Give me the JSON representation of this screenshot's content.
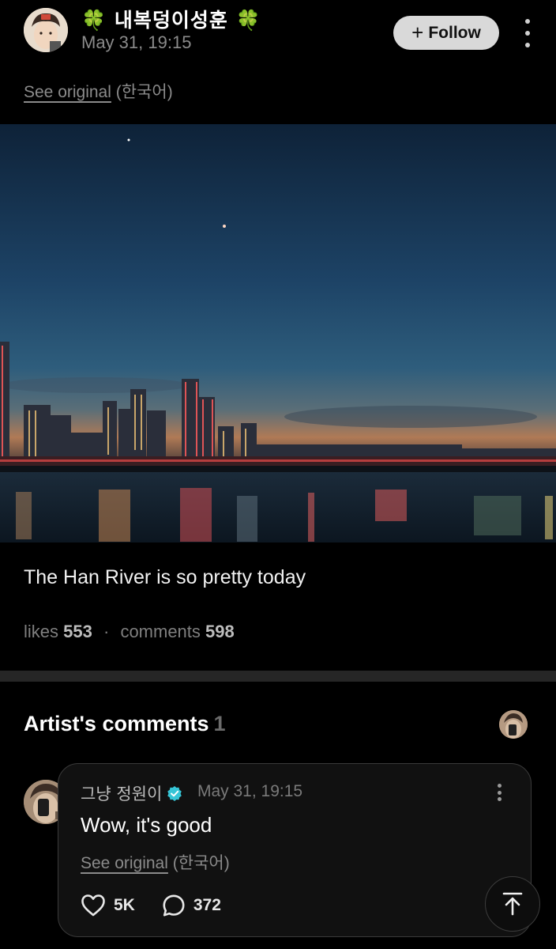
{
  "post": {
    "author": "🍀 내복덩이성훈 🍀",
    "author_name": "내복덩이성훈",
    "time": "May 31, 19:15",
    "follow_label": "Follow",
    "see_original": "See original",
    "language": "(한국어)",
    "caption": "The Han River is so pretty today",
    "likes_label": "likes",
    "likes": "553",
    "comments_label": "comments",
    "comments": "598",
    "separator": "·"
  },
  "artist_comments": {
    "heading": "Artist's comments",
    "count": "1",
    "items": [
      {
        "name": "그냥 정원이",
        "time": "May 31, 19:15",
        "text": "Wow, it's good",
        "see_original": "See original",
        "language": "(한국어)",
        "likes": "5K",
        "replies": "372"
      }
    ]
  },
  "icons": {
    "follow": "plus-icon",
    "more": "more-vertical-icon",
    "verified": "verified-badge-icon",
    "like": "heart-icon",
    "reply": "chat-bubble-icon",
    "scroll_top": "arrow-up-to-top-icon"
  },
  "colors": {
    "background": "#000000",
    "follow_button": "#d9d9d9",
    "verified": "#36c5d6",
    "divider": "#262626"
  }
}
